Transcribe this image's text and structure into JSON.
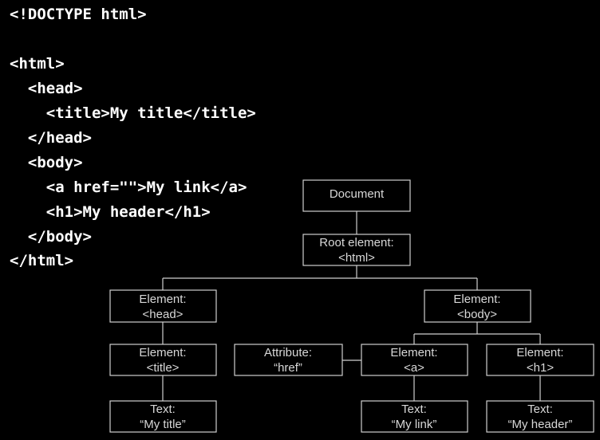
{
  "code_lines": [
    "<!DOCTYPE html>",
    "",
    "<html>",
    "  <head>",
    "    <title>My title</title>",
    "  </head>",
    "  <body>",
    "    <a href=\"\">My link</a>",
    "    <h1>My header</h1>",
    "  </body>",
    "</html>"
  ],
  "tree": {
    "document": {
      "line1": "Document"
    },
    "root": {
      "line1": "Root element:",
      "line2": "<html>"
    },
    "head": {
      "line1": "Element:",
      "line2": "<head>"
    },
    "body": {
      "line1": "Element:",
      "line2": "<body>"
    },
    "title": {
      "line1": "Element:",
      "line2": "<title>"
    },
    "href": {
      "line1": "Attribute:",
      "line2": "“href”"
    },
    "a": {
      "line1": "Element:",
      "line2": "<a>"
    },
    "h1": {
      "line1": "Element:",
      "line2": "<h1>"
    },
    "text_title": {
      "line1": "Text:",
      "line2": "“My title”"
    },
    "text_link": {
      "line1": "Text:",
      "line2": "“My link”"
    },
    "text_header": {
      "line1": "Text:",
      "line2": "“My header”"
    }
  }
}
